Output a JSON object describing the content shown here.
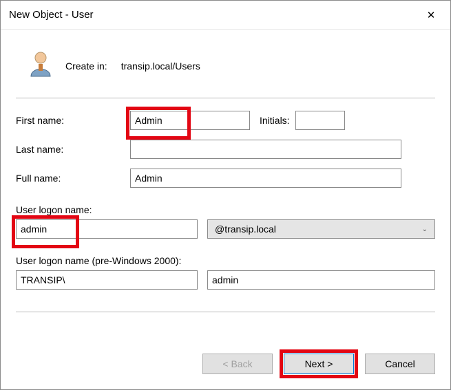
{
  "window": {
    "title": "New Object - User"
  },
  "createin": {
    "label": "Create in:",
    "path": "transip.local/Users"
  },
  "labels": {
    "first": "First name:",
    "initials": "Initials:",
    "last": "Last name:",
    "full": "Full name:",
    "logon": "User logon name:",
    "pre2k": "User logon name (pre-Windows 2000):"
  },
  "values": {
    "first": "Admin",
    "initials": "",
    "last": "",
    "full": "Admin",
    "logon": "admin",
    "domain_suffix": "@transip.local",
    "pre2k_domain": "TRANSIP\\",
    "pre2k_user": "admin"
  },
  "buttons": {
    "back": "< Back",
    "next": "Next >",
    "cancel": "Cancel"
  }
}
